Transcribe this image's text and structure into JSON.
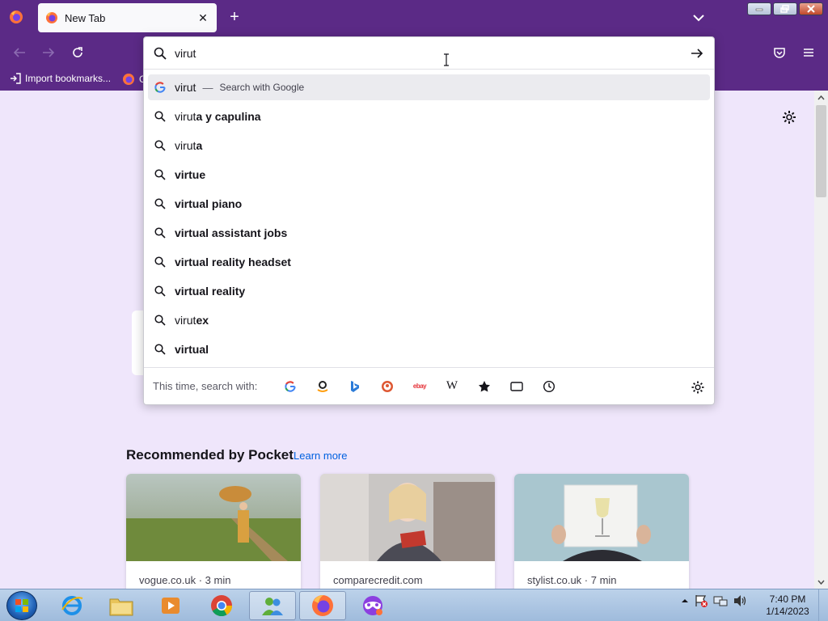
{
  "browser": {
    "tab": {
      "title": "New Tab",
      "close": "✕"
    },
    "newtab_symbol": "+",
    "bookmarks": [
      {
        "label": "Import bookmarks..."
      },
      {
        "label": "G"
      }
    ]
  },
  "urlbar": {
    "value": "virut"
  },
  "suggestions": [
    {
      "typed": "virut",
      "rest": "",
      "engine": "Search with Google",
      "dash": "—",
      "kind": "engine"
    },
    {
      "typed": "virut",
      "rest": "a y capulina",
      "kind": "search"
    },
    {
      "typed": "virut",
      "rest": "a",
      "kind": "search"
    },
    {
      "typed": "",
      "rest": "virtue",
      "kind": "search"
    },
    {
      "typed": "",
      "rest": "virtual piano",
      "kind": "search"
    },
    {
      "typed": "",
      "rest": "virtual assistant jobs",
      "kind": "search"
    },
    {
      "typed": "",
      "rest": "virtual reality headset",
      "kind": "search"
    },
    {
      "typed": "",
      "rest": "virtual reality",
      "kind": "search"
    },
    {
      "typed": "virut",
      "rest": "ex",
      "kind": "search"
    },
    {
      "typed": "",
      "rest": "virtual",
      "kind": "search"
    }
  ],
  "oneoff": {
    "label": "This time, search with:",
    "engines": [
      "google-icon",
      "amazon-icon",
      "bing-icon",
      "duckduckgo-icon",
      "ebay-icon",
      "wikipedia-icon",
      "bookmarks-icon",
      "tabs-icon",
      "history-icon"
    ],
    "wikipedia_glyph": "W",
    "ebay_glyph": "ebay"
  },
  "pocket": {
    "title": "Recommended by Pocket",
    "learn_more": "Learn more",
    "cards": [
      {
        "source": "vogue.co.uk · 3 min"
      },
      {
        "source": "comparecredit.com"
      },
      {
        "source": "stylist.co.uk · 7 min"
      }
    ]
  },
  "taskbar": {
    "time": "7:40 PM",
    "date": "1/14/2023"
  },
  "colors": {
    "toolbar": "#5b2a86",
    "page_bg": "#efe6fb",
    "link": "#0061e0"
  }
}
